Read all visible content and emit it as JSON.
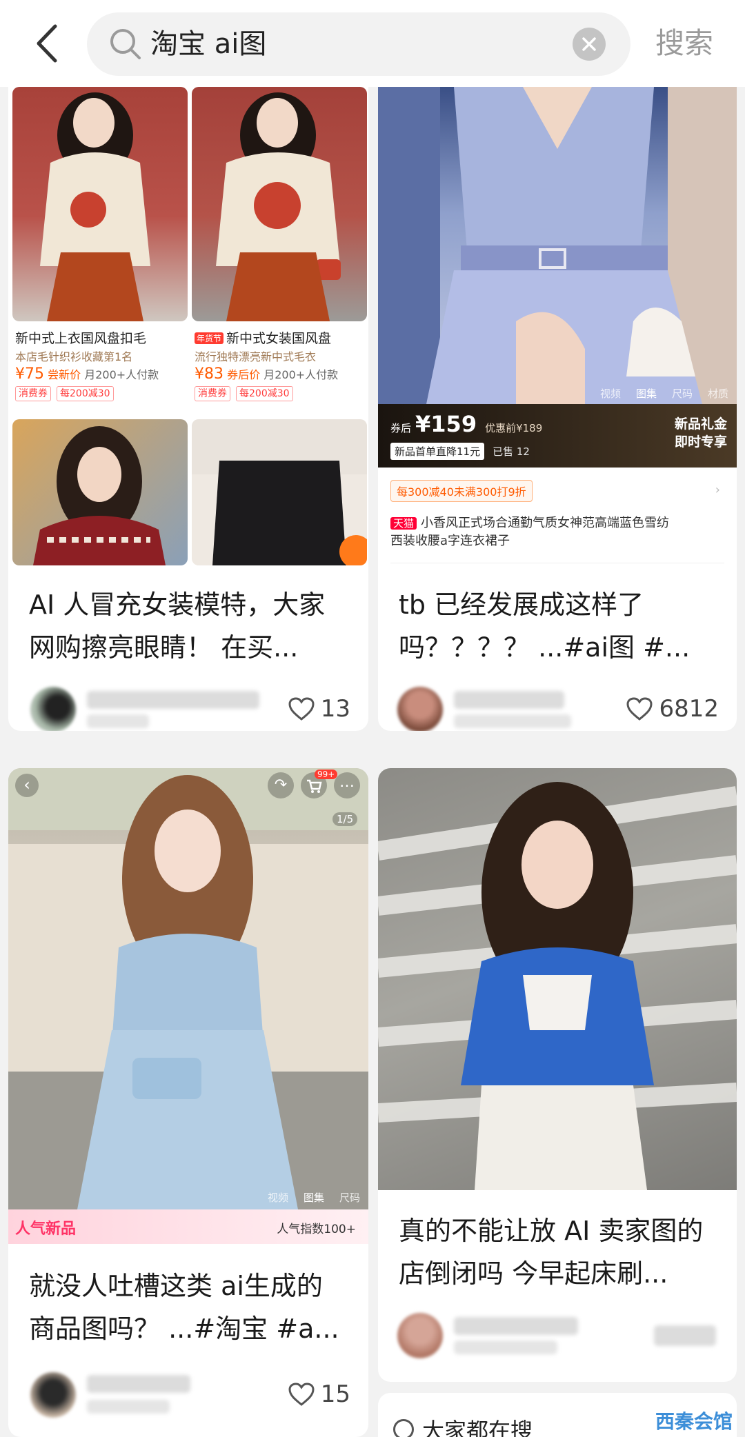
{
  "search": {
    "query": "淘宝 ai图",
    "button_label": "搜索"
  },
  "cards": [
    {
      "title_line1": "AI 人冒充女装模特，大家",
      "title_line2": "网购擦亮眼睛！ 在买...",
      "likes": "13",
      "products": [
        {
          "name": "新中式上衣国风盘扣毛",
          "sub": "本店毛针织衫收藏第1名",
          "price": "¥75",
          "price_note": "尝新价",
          "sold": "月200+人付款",
          "coupons": [
            "消费券",
            "每200减30"
          ]
        },
        {
          "badge": "年货节",
          "name": "新中式女装国风盘",
          "sub": "流行独特漂亮新中式毛衣",
          "price": "¥83",
          "price_note": "券后价",
          "sold": "月200+人付款",
          "coupons": [
            "消费券",
            "每200减30"
          ]
        }
      ]
    },
    {
      "title_line1": "tb 已经发展成这样了",
      "title_line2": "吗？？？？ ...#ai图 #...",
      "likes": "6812",
      "gallery_tabs": [
        "视频",
        "图集",
        "尺码",
        "材质"
      ],
      "price_prefix": "券后",
      "price": "¥159",
      "price_before": "优惠前¥189",
      "first_order": "新品首单直降11元",
      "sold": "已售 12",
      "promo_right_1": "新品礼金",
      "promo_right_2": "即时专享",
      "coupon_strip": "每300减40未满300打9折",
      "tmall_badge": "天猫",
      "product_line1": "小香风正式场合通勤气质女神范高端蓝色雪纺",
      "product_line2": "西装收腰a字连衣裙子"
    },
    {
      "title_line1": "就没人吐槽这类 ai生成的",
      "title_line2": "商品图吗？ ...#淘宝 #a...",
      "likes": "15",
      "cart_badge": "99+",
      "page_indicator": "1/5",
      "gallery_tabs": [
        "视频",
        "图集",
        "尺码"
      ],
      "banner_left": "人气新品",
      "banner_right": "人气指数100+"
    },
    {
      "title_line1": "真的不能让放 AI 卖家图的",
      "title_line2": "店倒闭吗 今早起床刷..."
    }
  ],
  "bottom_partial_text": "大家都在搜",
  "watermark": "西秦会馆",
  "colors": {
    "accent": "#ff5a00",
    "price_red": "#ff3d3d",
    "tmall": "#ff0036"
  }
}
